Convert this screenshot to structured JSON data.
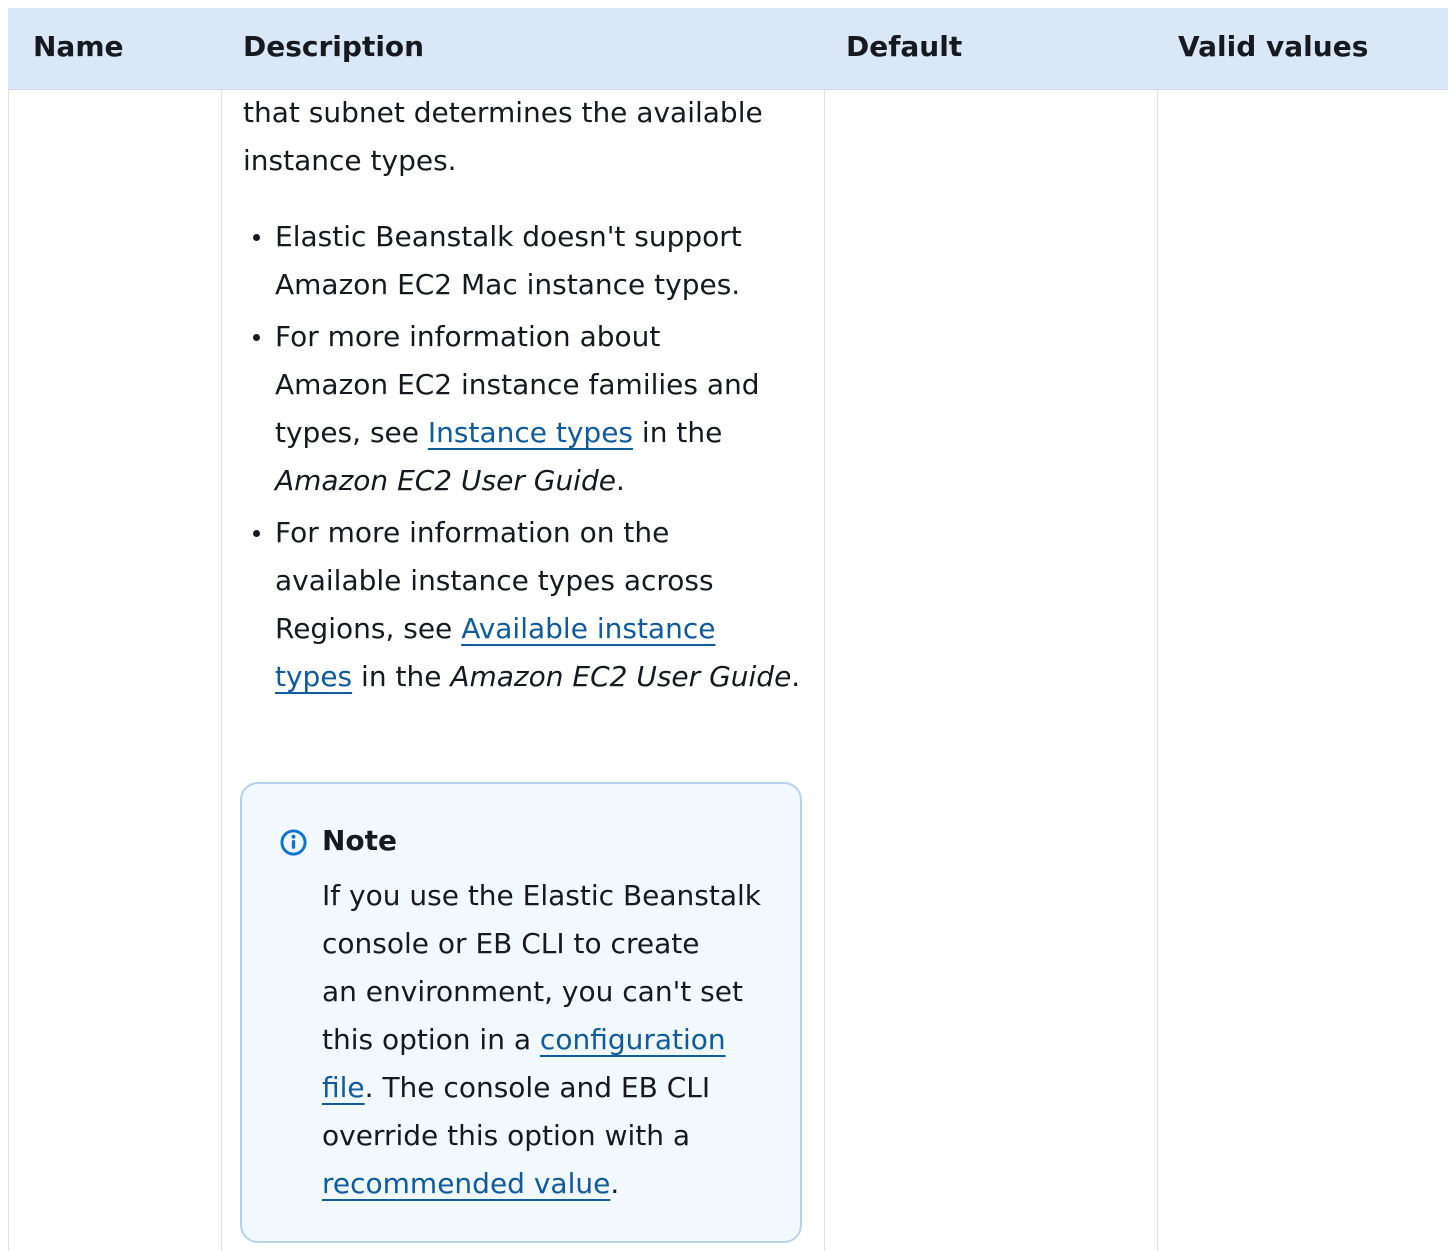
{
  "table": {
    "headers": {
      "name": "Name",
      "description": "Description",
      "default": "Default",
      "valid_values": "Valid values"
    }
  },
  "description": {
    "intro_lines": [
      "that subnet determines the available",
      "instance types."
    ],
    "bullet1": {
      "line1": "Elastic Beanstalk doesn't support",
      "line2": "Amazon EC2 Mac instance types."
    },
    "bullet2": {
      "line1": "For more information about",
      "line2": "Amazon EC2 instance families and",
      "line3_pre": "types, see ",
      "line3_link": "Instance types",
      "line3_post": " in the",
      "line4_italic": "Amazon EC2 User Guide",
      "line4_post": "."
    },
    "bullet3": {
      "line1": "For more information on the",
      "line2": "available instance types across",
      "line3_pre": "Regions, see ",
      "line3_link": "Available instance",
      "line4_link": "types",
      "line4_mid": " in the ",
      "line4_italic": "Amazon EC2 User Guide",
      "line4_post": "."
    }
  },
  "note": {
    "icon": "info-icon",
    "title": "Note",
    "line1": "If you use the Elastic Beanstalk",
    "line2": "console or EB CLI to create",
    "line3": "an environment, you can't set",
    "line4_pre": "this option in a ",
    "line4_link": "configuration",
    "line5_link": "file",
    "line5_post": ". The console and EB CLI",
    "line6": "override this option with a",
    "line7_link": "recommended value",
    "line7_post": "."
  },
  "colors": {
    "header_bg": "#d9e7f6",
    "link": "#0f5b9c",
    "note_bg": "#f1f8fe",
    "note_border": "#b6d1ea",
    "info_icon": "#0972d3"
  }
}
